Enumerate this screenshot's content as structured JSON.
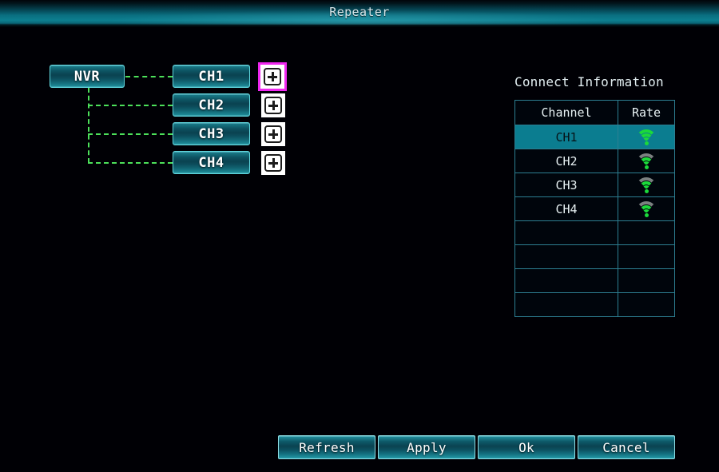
{
  "window": {
    "title": "Repeater"
  },
  "tree": {
    "root": {
      "label": "NVR"
    },
    "nodes": [
      {
        "label": "CH1",
        "expand_icon": "plus-icon",
        "focused": true
      },
      {
        "label": "CH2",
        "expand_icon": "plus-icon",
        "focused": false
      },
      {
        "label": "CH3",
        "expand_icon": "plus-icon",
        "focused": false
      },
      {
        "label": "CH4",
        "expand_icon": "plus-icon",
        "focused": false
      }
    ]
  },
  "connect_information": {
    "title": "Connect Information",
    "columns": [
      "Channel",
      "Rate"
    ],
    "rows": [
      {
        "channel": "CH1",
        "rate_icon": "wifi-signal-icon",
        "bars": 4,
        "selected": true
      },
      {
        "channel": "CH2",
        "rate_icon": "wifi-signal-icon",
        "bars": 3,
        "selected": false
      },
      {
        "channel": "CH3",
        "rate_icon": "wifi-signal-icon",
        "bars": 3,
        "selected": false
      },
      {
        "channel": "CH4",
        "rate_icon": "wifi-signal-icon",
        "bars": 3,
        "selected": false
      },
      {
        "channel": "",
        "rate_icon": "",
        "bars": 0,
        "selected": false
      },
      {
        "channel": "",
        "rate_icon": "",
        "bars": 0,
        "selected": false
      },
      {
        "channel": "",
        "rate_icon": "",
        "bars": 0,
        "selected": false
      },
      {
        "channel": "",
        "rate_icon": "",
        "bars": 0,
        "selected": false
      }
    ]
  },
  "footer": {
    "buttons": [
      {
        "label": "Refresh"
      },
      {
        "label": "Apply"
      },
      {
        "label": "Ok"
      },
      {
        "label": "Cancel"
      }
    ]
  },
  "colors": {
    "background": "#000005",
    "titlebar_accent": "#0c7f90",
    "node_border": "#5fd6dd",
    "focus_magenta": "#ef27ef",
    "dash_green": "#4ce05a",
    "signal_green": "#1bd93a",
    "signal_gray": "#7b8080",
    "table_border": "#2d7f92",
    "row_selected": "#0b7d90"
  }
}
